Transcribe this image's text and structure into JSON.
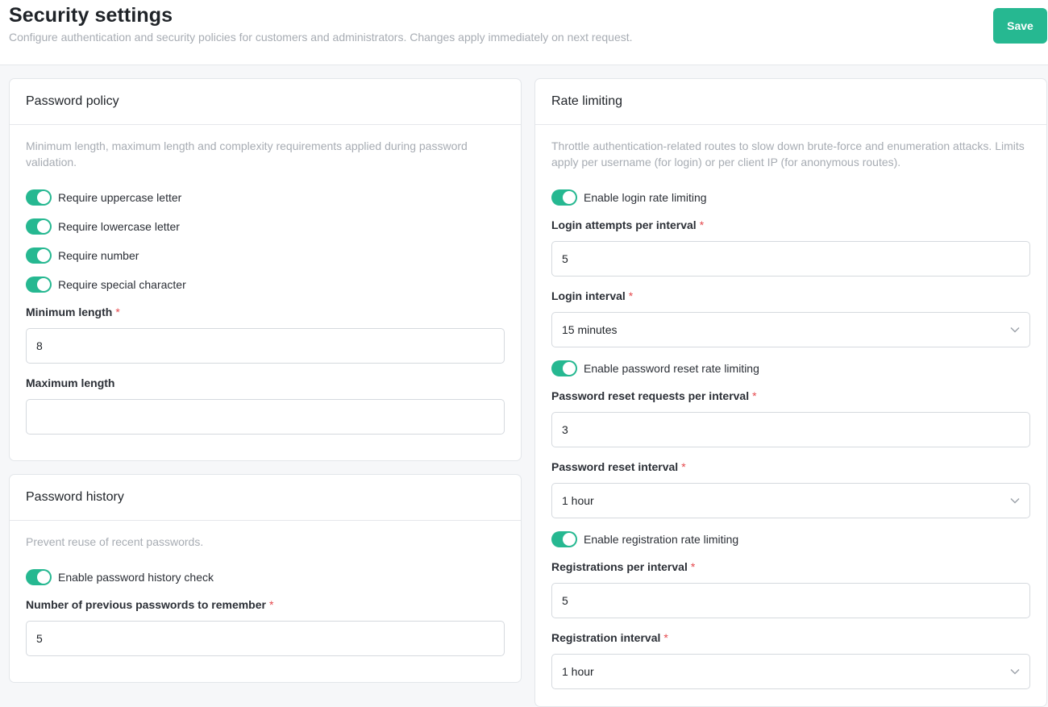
{
  "header": {
    "title": "Security settings",
    "subtitle": "Configure authentication and security policies for customers and administrators. Changes apply immediately on next request.",
    "save_label": "Save"
  },
  "password_policy": {
    "title": "Password policy",
    "description": "Minimum length, maximum length and complexity requirements applied during password validation.",
    "toggles": [
      {
        "label": "Require uppercase letter",
        "on": true
      },
      {
        "label": "Require lowercase letter",
        "on": true
      },
      {
        "label": "Require number",
        "on": true
      },
      {
        "label": "Require special character",
        "on": true
      }
    ],
    "min_length": {
      "label": "Minimum length",
      "required_mark": "*",
      "value": "8"
    },
    "max_length": {
      "label": "Maximum length",
      "value": ""
    }
  },
  "password_history": {
    "title": "Password history",
    "description": "Prevent reuse of recent passwords.",
    "toggle": {
      "label": "Enable password history check",
      "on": true
    },
    "remember": {
      "label": "Number of previous passwords to remember",
      "required_mark": "*",
      "value": "5"
    }
  },
  "rate_limiting": {
    "title": "Rate limiting",
    "description": "Throttle authentication-related routes to slow down brute-force and enumeration attacks. Limits apply per username (for login) or per client IP (for anonymous routes).",
    "login_toggle": {
      "label": "Enable login rate limiting",
      "on": true
    },
    "login_attempts": {
      "label": "Login attempts per interval",
      "required_mark": "*",
      "value": "5"
    },
    "login_interval": {
      "label": "Login interval",
      "required_mark": "*",
      "value": "15 minutes"
    },
    "reset_toggle": {
      "label": "Enable password reset rate limiting",
      "on": true
    },
    "reset_requests": {
      "label": "Password reset requests per interval",
      "required_mark": "*",
      "value": "3"
    },
    "reset_interval": {
      "label": "Password reset interval",
      "required_mark": "*",
      "value": "1 hour"
    },
    "registration_toggle": {
      "label": "Enable registration rate limiting",
      "on": true
    },
    "registrations": {
      "label": "Registrations per interval",
      "required_mark": "*",
      "value": "5"
    },
    "registration_interval": {
      "label": "Registration interval",
      "required_mark": "*",
      "value": "1 hour"
    }
  },
  "colors": {
    "accent": "#26b891",
    "required": "#e5484d",
    "muted_text": "#a7acb3"
  },
  "icons": {
    "select_chevron": "chevron-down-icon"
  }
}
